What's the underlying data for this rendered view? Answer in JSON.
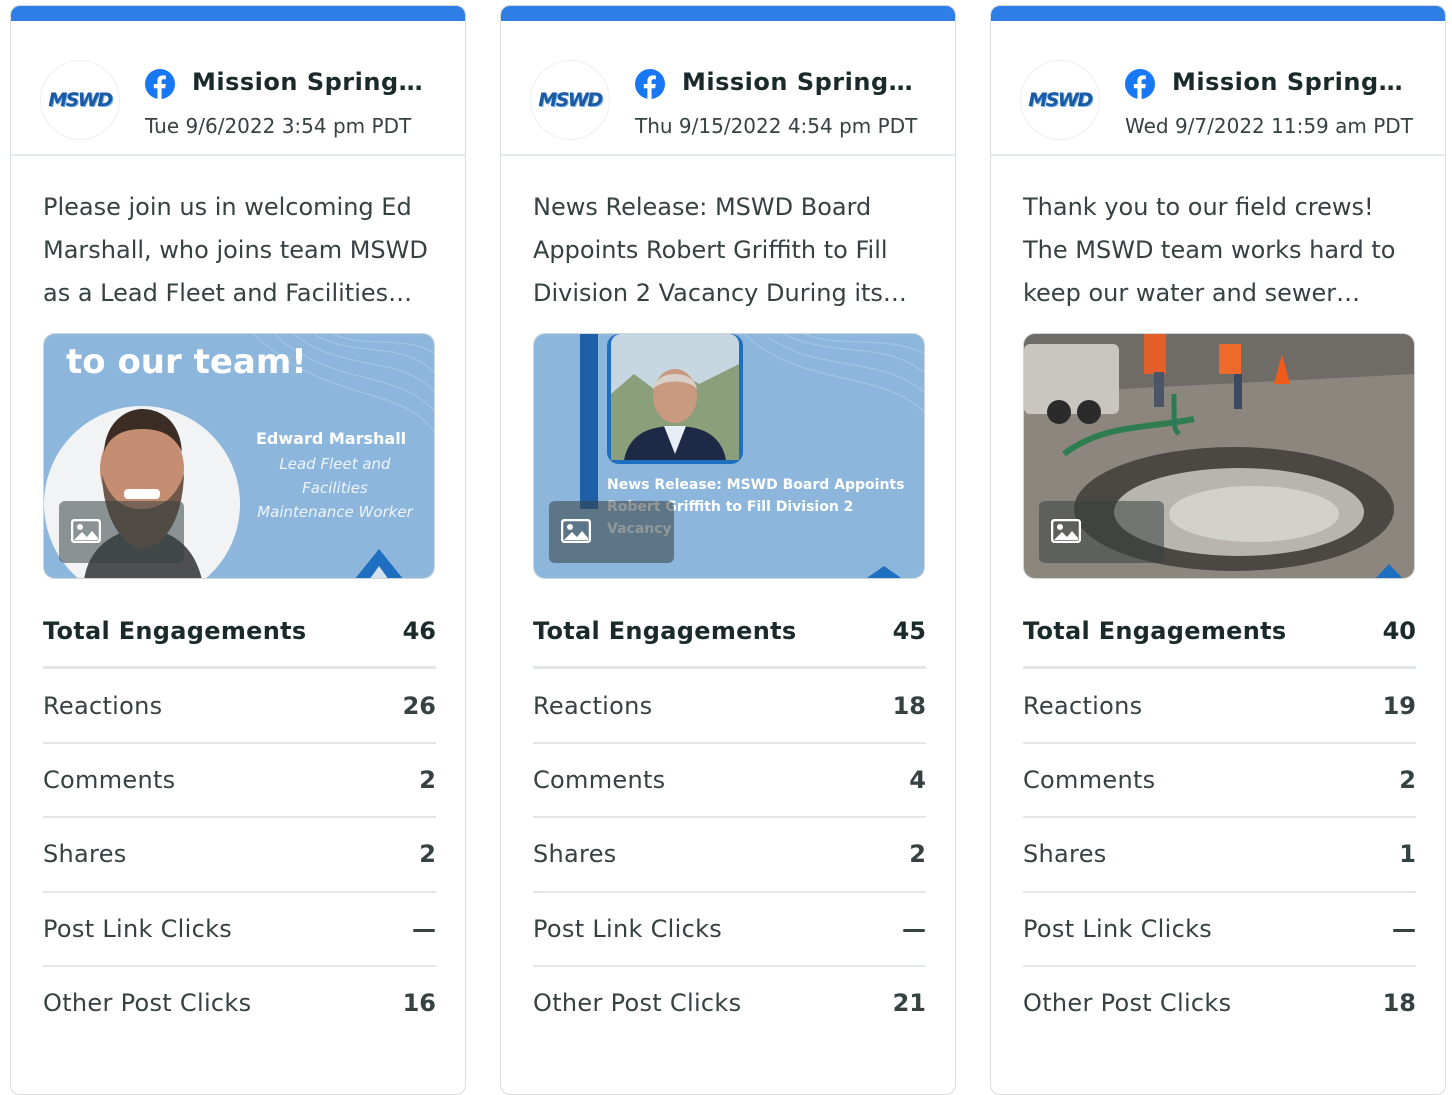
{
  "colors": {
    "accent_bar": "#2f7ee6",
    "facebook_blue": "#1877f2",
    "image_blue": "#8db6dc"
  },
  "cards": [
    {
      "avatar_logo": "MSWD",
      "platform_icon": "facebook-icon",
      "account_name": "Mission Springs Water District",
      "date": "Tue 9/6/2022 3:54 pm PDT",
      "text": "Please join us in welcoming Ed Marshall, who joins team MSWD as a Lead Fleet and Facilities Maintenance Worker.",
      "image": {
        "headline": "to our team!",
        "name": "Edward Marshall",
        "role_line1": "Lead Fleet and Facilities",
        "role_line2": "Maintenance Worker"
      },
      "metrics": {
        "total_label": "Total Engagements",
        "total": "46",
        "reactions_label": "Reactions",
        "reactions": "26",
        "comments_label": "Comments",
        "comments": "2",
        "shares_label": "Shares",
        "shares": "2",
        "link_clicks_label": "Post Link Clicks",
        "link_clicks": "—",
        "other_clicks_label": "Other Post Clicks",
        "other_clicks": "16"
      }
    },
    {
      "avatar_logo": "MSWD",
      "platform_icon": "facebook-icon",
      "account_name": "Mission Springs Water District",
      "date": "Thu 9/15/2022 4:54 pm PDT",
      "text": "News Release: MSWD Board Appoints Robert Griffith to Fill Division 2 Vacancy During its regular meeting",
      "image": {
        "headline": "News Release: MSWD Board Appoints Robert Griffith to Fill Division 2 Vacancy"
      },
      "metrics": {
        "total_label": "Total Engagements",
        "total": "45",
        "reactions_label": "Reactions",
        "reactions": "18",
        "comments_label": "Comments",
        "comments": "4",
        "shares_label": "Shares",
        "shares": "2",
        "link_clicks_label": "Post Link Clicks",
        "link_clicks": "—",
        "other_clicks_label": "Other Post Clicks",
        "other_clicks": "21"
      }
    },
    {
      "avatar_logo": "MSWD",
      "platform_icon": "facebook-icon",
      "account_name": "Mission Springs Water District",
      "date": "Wed 9/7/2022 11:59 am PDT",
      "text": "Thank you to our field crews! The MSWD team works hard to keep our water and sewer systems running.",
      "image": {},
      "metrics": {
        "total_label": "Total Engagements",
        "total": "40",
        "reactions_label": "Reactions",
        "reactions": "19",
        "comments_label": "Comments",
        "comments": "2",
        "shares_label": "Shares",
        "shares": "1",
        "link_clicks_label": "Post Link Clicks",
        "link_clicks": "—",
        "other_clicks_label": "Other Post Clicks",
        "other_clicks": "18"
      }
    }
  ]
}
